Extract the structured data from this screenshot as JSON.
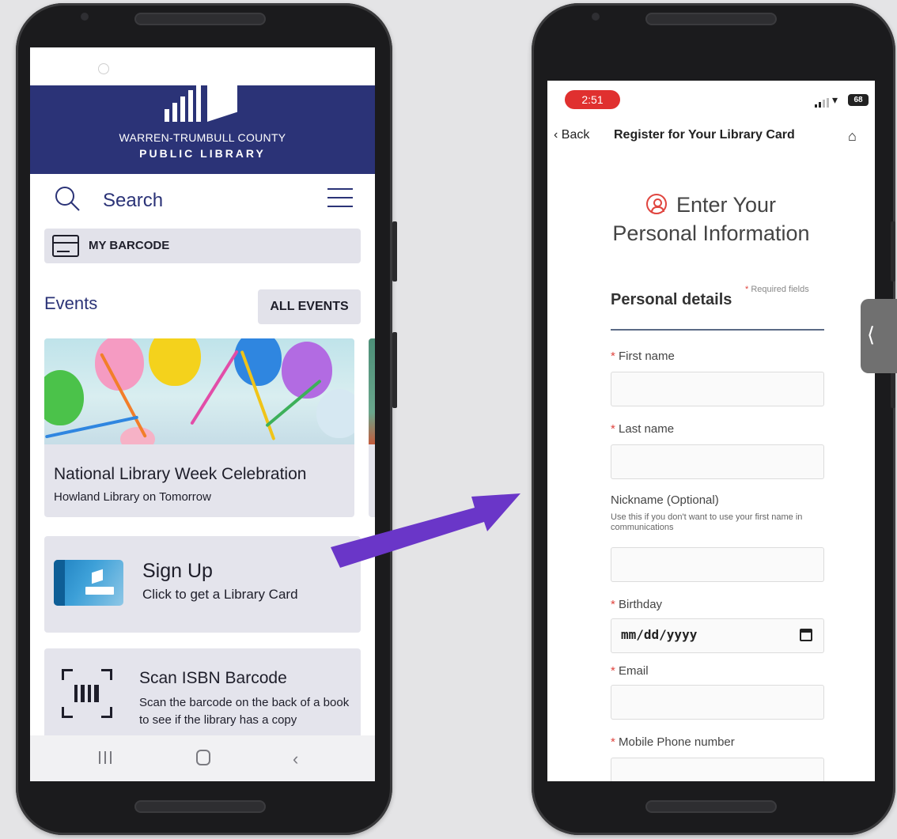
{
  "left_app": {
    "library_name_line1": "WARREN-TRUMBULL COUNTY",
    "library_name_line2": "PUBLIC LIBRARY",
    "search_label": "Search",
    "barcode_label": "MY BARCODE",
    "events_title": "Events",
    "all_events_label": "ALL EVENTS",
    "event": {
      "title": "National Library Week Celebration",
      "subtitle": "Howland Library on Tomorrow"
    },
    "signup": {
      "title": "Sign Up",
      "subtitle": "Click to get a Library Card"
    },
    "scan": {
      "title": "Scan ISBN Barcode",
      "subtitle": "Scan the barcode on the back of a book to see if the library has a copy"
    },
    "brand_color": "#2b3377",
    "nav_icons": [
      "recent-apps-icon",
      "home-icon",
      "back-icon"
    ]
  },
  "right_app": {
    "status": {
      "time": "2:51",
      "battery": "68"
    },
    "nav": {
      "back_label": "Back",
      "title": "Register for Your Library Card"
    },
    "heading_line1": "Enter Your",
    "heading_line2": "Personal Information",
    "section_title": "Personal details",
    "required_note": "Required fields",
    "fields": {
      "first_name_label": "First name",
      "last_name_label": "Last name",
      "nickname_label": "Nickname (Optional)",
      "nickname_help": "Use this if you don't want to use your first name in communications",
      "birthday_label": "Birthday",
      "birthday_value": "mm/dd/yyyy",
      "email_label": "Email",
      "mobile_label": "Mobile Phone number"
    },
    "accent_color": "#e0453f",
    "side_tab_glyph": "⟨"
  }
}
